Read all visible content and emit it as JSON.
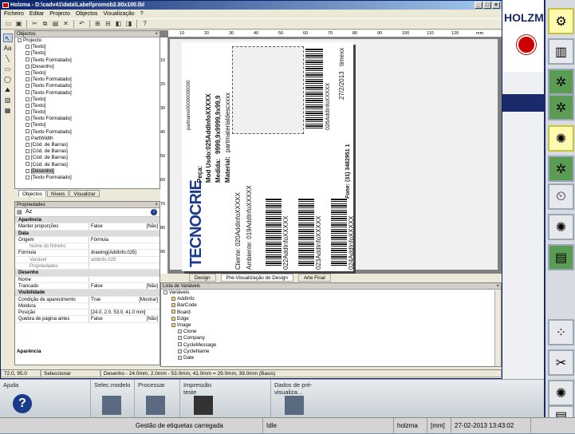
{
  "window": {
    "title": "Holzma - D:\\cadv41\\data\\Label\\promob2.80x100.lbl"
  },
  "menu": [
    "Ficheiro",
    "Editar",
    "Projecto",
    "Objectos",
    "Visualização",
    "?"
  ],
  "objects_panel": {
    "title": "Objectos",
    "items": [
      "Projecto",
      "[Texto]",
      "[Texto]",
      "[Texto Formatado]",
      "[Desenho]",
      "[Texto]",
      "[Texto Formatado]",
      "[Texto Formatado]",
      "[Texto Formatado]",
      "[Texto]",
      "[Texto]",
      "[Texto]",
      "[Texto Formatado]",
      "[Texto]",
      "[Texto Formatado]",
      "PartWidth",
      "[Cód. de Barras]",
      "[Cód. de Barras]",
      "[Cód. de Barras]",
      "[Cód. de Barras]",
      "[Desenho]",
      "[Texto Formatado]"
    ],
    "tabs": [
      "Objectos",
      "Níveis",
      "Visualizar"
    ]
  },
  "properties": {
    "title": "Propriedades",
    "rows": [
      {
        "t": "cat",
        "k": "Aparência"
      },
      {
        "t": "row",
        "k": "Manter proporções",
        "v": "False",
        "r": "[Não]"
      },
      {
        "t": "cat",
        "k": "Data"
      },
      {
        "t": "row",
        "k": "Origem",
        "v": "Fórmula",
        "r": ""
      },
      {
        "t": "sub",
        "k": "Nome do ficheiro",
        "v": "",
        "r": ""
      },
      {
        "t": "row",
        "k": "Fórmula",
        "v": "drawing(AddInfo.025)",
        "r": ""
      },
      {
        "t": "sub",
        "k": "Variável",
        "v": "addinfo.025",
        "r": ""
      },
      {
        "t": "sub",
        "k": "Propriedades",
        "v": "",
        "r": ""
      },
      {
        "t": "cat",
        "k": "Desenho"
      },
      {
        "t": "row",
        "k": "Nome",
        "v": "",
        "r": ""
      },
      {
        "t": "row",
        "k": "Trancado",
        "v": "False",
        "r": "[Não]"
      },
      {
        "t": "cat",
        "k": "Visibilidade"
      },
      {
        "t": "row",
        "k": "Condição de aparecimento",
        "v": "True",
        "r": "[Mostrar]"
      },
      {
        "t": "row",
        "k": "Moldura",
        "v": "",
        "r": ""
      },
      {
        "t": "row",
        "k": "Posição",
        "v": "[24.0, 2.0, 53.0, 41.0 mm]",
        "r": ""
      },
      {
        "t": "row",
        "k": "Quebra de página antes",
        "v": "False",
        "r": "[Não]"
      }
    ],
    "footer": "Aparência"
  },
  "ruler": {
    "h": [
      "10",
      "20",
      "30",
      "40",
      "50",
      "60",
      "70",
      "80",
      "90",
      "100",
      "110",
      "120",
      "mm"
    ],
    "v": [
      "10",
      "20",
      "30",
      "40",
      "50",
      "60",
      "70",
      "80",
      "90",
      "mm"
    ]
  },
  "label": {
    "parte": "partnarne00000000000",
    "lines": [
      "Peça:",
      "Mod Usdo:025AddInfoXXXXX",
      "Medida:",
      "9999,9x9999,9x99,9",
      "Material:",
      "partmaterialdescxxxx"
    ],
    "cliente": "Cliente: 020AddInfoXXXXX",
    "ambiente": "Ambiente: 019AddInfoXXXXX",
    "codes": [
      "022AddInfoXXXXX",
      "023AddInfoXXXXX",
      "024AddInfoXXXXX"
    ],
    "fone": "Fone: (31) 3482951 1",
    "addinfo26": "026AddInfoXXXXX",
    "date": "27/2/2013",
    "timex": "timexx",
    "logo": "TECNOCRIE"
  },
  "viewtabs": [
    "Design",
    "Pré-Visualização do Design",
    "Arte Final"
  ],
  "variables": {
    "title": "Lista de Variáveis",
    "root": "Variáveis",
    "items": [
      "AddInfo",
      "BarCode",
      "Board",
      "Edge",
      "Image",
      "Clone",
      "Company",
      "CycleMessage",
      "CycleName",
      "Date"
    ]
  },
  "status": {
    "coords": "72.0, 95.0",
    "mode": "Seleccionar",
    "design": "Desenho - 24.0mm, 2.0mm - 53.0mm, 41.0mm = 29.0mm, 39.0mm (Basis)"
  },
  "bottom": {
    "ajuda": "Ajuda",
    "selec": "Selec.modelo",
    "processar": "Processar",
    "impressao": "Impressão teste",
    "dados": "Dados de pré-visualiza..."
  },
  "bstatus": {
    "msg": "Gestão de etiquetas carregada",
    "state": "Idle",
    "user": "holzma",
    "unit": "[mm]",
    "datetime": "27-02-2013 13:43:02"
  },
  "brand": "HOLZMA"
}
